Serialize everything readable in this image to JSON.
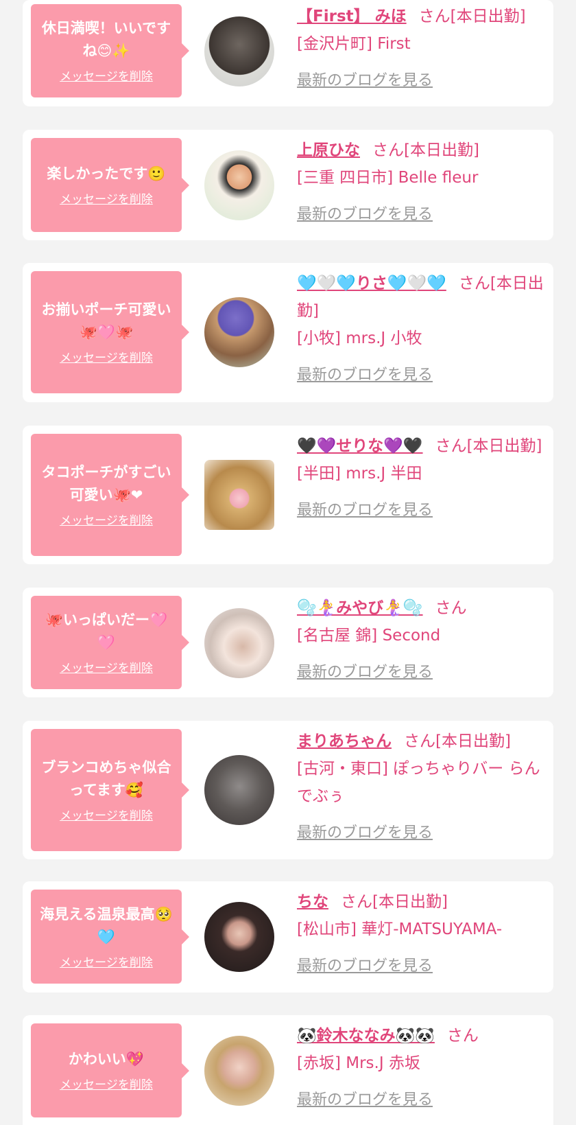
{
  "colors": {
    "accent": "#e0457a",
    "bubble": "#fb9bab",
    "muted": "#9a9a9a",
    "background": "#f3f3f3"
  },
  "messages": [
    {
      "bubble_text": "休日満喫！いいですね😊✨",
      "delete_label": "メッセージを削除",
      "name": "【First】 みほ",
      "suffix": "さん[本日出勤]",
      "shop": "[金沢片町] First",
      "blog_label": "最新のブログを見る"
    },
    {
      "bubble_text": "楽しかったです🙂",
      "delete_label": "メッセージを削除",
      "name": "上原ひな",
      "suffix": "さん[本日出勤]",
      "shop": "[三重 四日市] Belle fleur",
      "blog_label": "最新のブログを見る"
    },
    {
      "bubble_text": "お揃いポーチ可愛い🐙🩷🐙",
      "delete_label": "メッセージを削除",
      "name": "🩵🤍🩵りさ🩵🤍🩵",
      "suffix": "さん[本日出勤]",
      "shop": "[小牧] mrs.J 小牧",
      "blog_label": "最新のブログを見る"
    },
    {
      "bubble_text": "タコポーチがすごい可愛い🐙❤",
      "delete_label": "メッセージを削除",
      "name": "🖤💜せりな💜🖤",
      "suffix": "さん[本日出勤]",
      "shop": "[半田] mrs.J 半田",
      "blog_label": "最新のブログを見る"
    },
    {
      "bubble_text": "🐙いっぱいだー🩷🩷",
      "delete_label": "メッセージを削除",
      "name": "🫧🧜‍♀️みやび🧜‍♀️🫧",
      "suffix": "さん",
      "shop": "[名古屋 錦] Second",
      "blog_label": "最新のブログを見る"
    },
    {
      "bubble_text": "ブランコめちゃ似合ってます🥰",
      "delete_label": "メッセージを削除",
      "name": "まりあちゃん",
      "suffix": "さん[本日出勤]",
      "shop": "[古河・東口] ぽっちゃりバー らんでぶぅ",
      "blog_label": "最新のブログを見る"
    },
    {
      "bubble_text": "海見える温泉最高🥺🩵",
      "delete_label": "メッセージを削除",
      "name": "ちな",
      "suffix": "さん[本日出勤]",
      "shop": "[松山市] 華灯-MATSUYAMA-",
      "blog_label": "最新のブログを見る"
    },
    {
      "bubble_text": "かわいい💖",
      "delete_label": "メッセージを削除",
      "name": "🐼鈴木ななみ🐼🐼",
      "suffix": "さん",
      "shop": "[赤坂] Mrs.J 赤坂",
      "blog_label": "最新のブログを見る"
    }
  ]
}
